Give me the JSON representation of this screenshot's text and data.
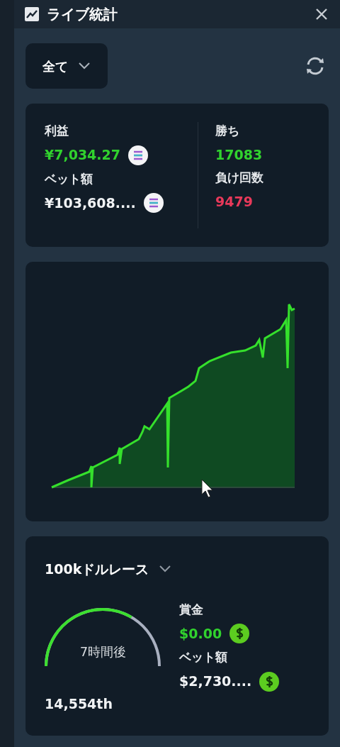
{
  "window": {
    "title": "ライブ統計"
  },
  "filter": {
    "value": "全て"
  },
  "stats": {
    "left": [
      {
        "label": "利益",
        "value": "¥7,034.27",
        "color": "#31d22e",
        "kind": "token"
      },
      {
        "label": "ベット額",
        "value": "¥103,608....",
        "color": "#f1f3f5",
        "kind": "token"
      }
    ],
    "right": [
      {
        "label": "勝ち",
        "value": "17083",
        "color": "#31d22e"
      },
      {
        "label": "負け回数",
        "value": "9479",
        "color": "#e8395a"
      }
    ]
  },
  "race": {
    "title": "100kドルレース",
    "timer": {
      "label": "7時間後"
    },
    "rank": "14,554th",
    "stats": [
      {
        "label": "賞金",
        "value": "$0.00",
        "color": "#31d22e",
        "kind": "dollar"
      },
      {
        "label": "ベット額",
        "value": "$2,730....",
        "color": "#f1f3f5",
        "kind": "dollar"
      }
    ]
  }
}
